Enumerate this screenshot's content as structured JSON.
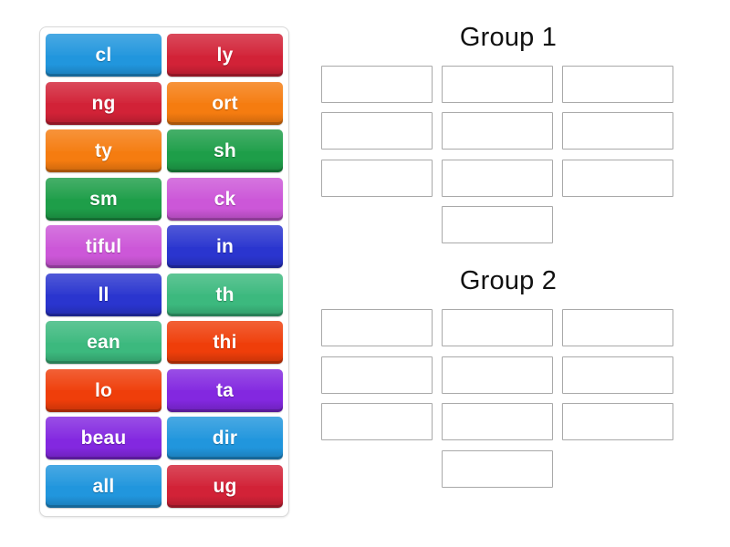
{
  "word_bank": {
    "name": "word-bank",
    "tiles": [
      {
        "label": "cl",
        "color": "#2196dd"
      },
      {
        "label": "ly",
        "color": "#d22237"
      },
      {
        "label": "ng",
        "color": "#d22237"
      },
      {
        "label": "ort",
        "color": "#f57c10"
      },
      {
        "label": "ty",
        "color": "#f57c10"
      },
      {
        "label": "sh",
        "color": "#1e9e49"
      },
      {
        "label": "sm",
        "color": "#1e9e49"
      },
      {
        "label": "ck",
        "color": "#cc57d8"
      },
      {
        "label": "tiful",
        "color": "#cc57d8"
      },
      {
        "label": "in",
        "color": "#2a35cf"
      },
      {
        "label": "ll",
        "color": "#2a35cf"
      },
      {
        "label": "th",
        "color": "#3cb97e"
      },
      {
        "label": "ean",
        "color": "#3cb97e"
      },
      {
        "label": "thi",
        "color": "#ef3e0a"
      },
      {
        "label": "lo",
        "color": "#ef3e0a"
      },
      {
        "label": "ta",
        "color": "#8328e0"
      },
      {
        "label": "beau",
        "color": "#8328e0"
      },
      {
        "label": "dir",
        "color": "#2196dd"
      },
      {
        "label": "all",
        "color": "#2196dd"
      },
      {
        "label": "ug",
        "color": "#d22237"
      }
    ]
  },
  "groups": [
    {
      "id": "group-1",
      "title": "Group 1",
      "slots": [
        "",
        "",
        "",
        "",
        "",
        "",
        "",
        "",
        "",
        ""
      ],
      "slot_count": 10,
      "last_row_centered": true
    },
    {
      "id": "group-2",
      "title": "Group 2",
      "slots": [
        "",
        "",
        "",
        "",
        "",
        "",
        "",
        "",
        "",
        ""
      ],
      "slot_count": 10,
      "last_row_centered": true
    }
  ],
  "theme": {
    "page_background": "#ffffff",
    "panel_border": "#d9d9d9",
    "slot_border": "#a9a9a9",
    "title_color": "#111111",
    "tile_text_color": "#ffffff"
  }
}
